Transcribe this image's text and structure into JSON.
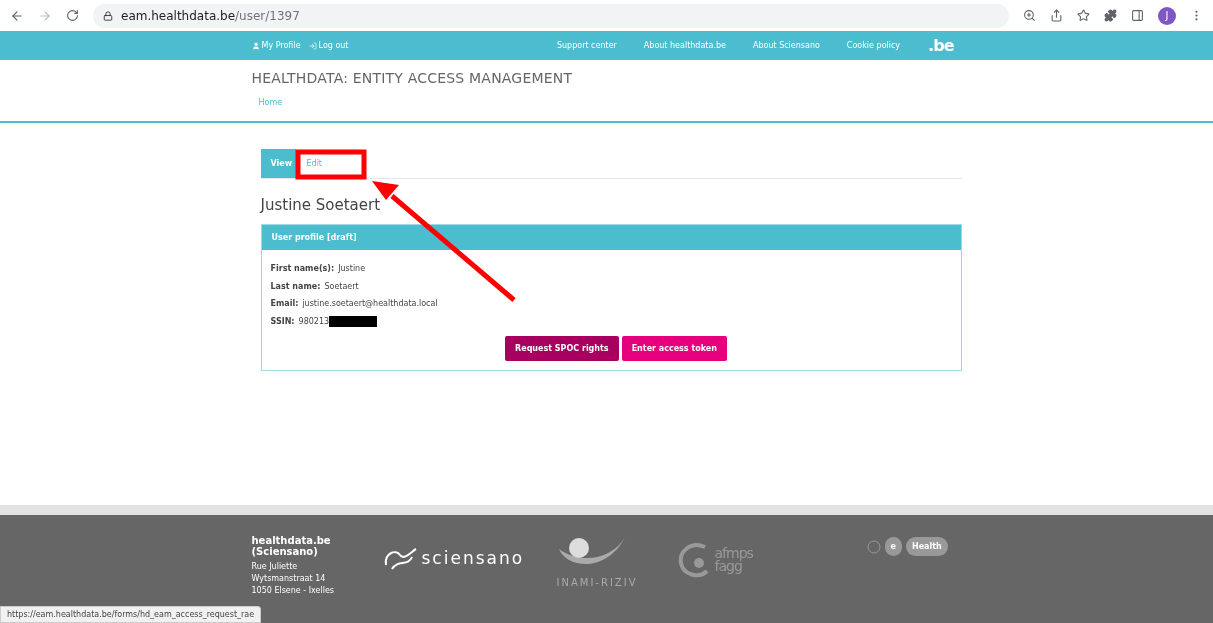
{
  "browser": {
    "url_host": "eam.healthdata.be",
    "url_path": "/user/1397",
    "avatar": "J"
  },
  "top_bar": {
    "left_links": [
      "My Profile",
      "Log out"
    ],
    "right_links": [
      "Support center",
      "About healthdata.be",
      "About Sciensano",
      "Cookie policy"
    ],
    "logo": ".be"
  },
  "header": {
    "title": "HEALTHDATA: ENTITY ACCESS MANAGEMENT",
    "breadcrumb": "Home"
  },
  "tabs": [
    {
      "label": "View",
      "selected": true
    },
    {
      "label": "Edit",
      "selected": false
    }
  ],
  "user_name": "Justine Soetaert",
  "panel": {
    "title": "User profile [draft]",
    "fields": [
      {
        "label": "First name(s):",
        "value": "Justine"
      },
      {
        "label": "Last name:",
        "value": "Soetaert"
      },
      {
        "label": "Email:",
        "value": "justine.soetaert@healthdata.local"
      },
      {
        "label": "SSIN:",
        "value": "980213",
        "redacted": true
      }
    ],
    "buttons": [
      {
        "label": "Request SPOC rights",
        "kind": "dark"
      },
      {
        "label": "Enter access token",
        "kind": "bright"
      }
    ]
  },
  "footer": {
    "org": "healthdata.be (Sciensano)",
    "address": [
      "Rue Juliette",
      "Wytsmanstraat 14",
      "1050 Elsene - Ixelles"
    ],
    "logos": {
      "sciensano": "sciensano",
      "inami": "INAMI-RIZIV",
      "afmps": [
        "afmps",
        "fagg"
      ],
      "ehealth": [
        "e",
        "Health"
      ]
    }
  },
  "status_url": "https://eam.healthdata.be/forms/hd_eam_access_request_rae"
}
